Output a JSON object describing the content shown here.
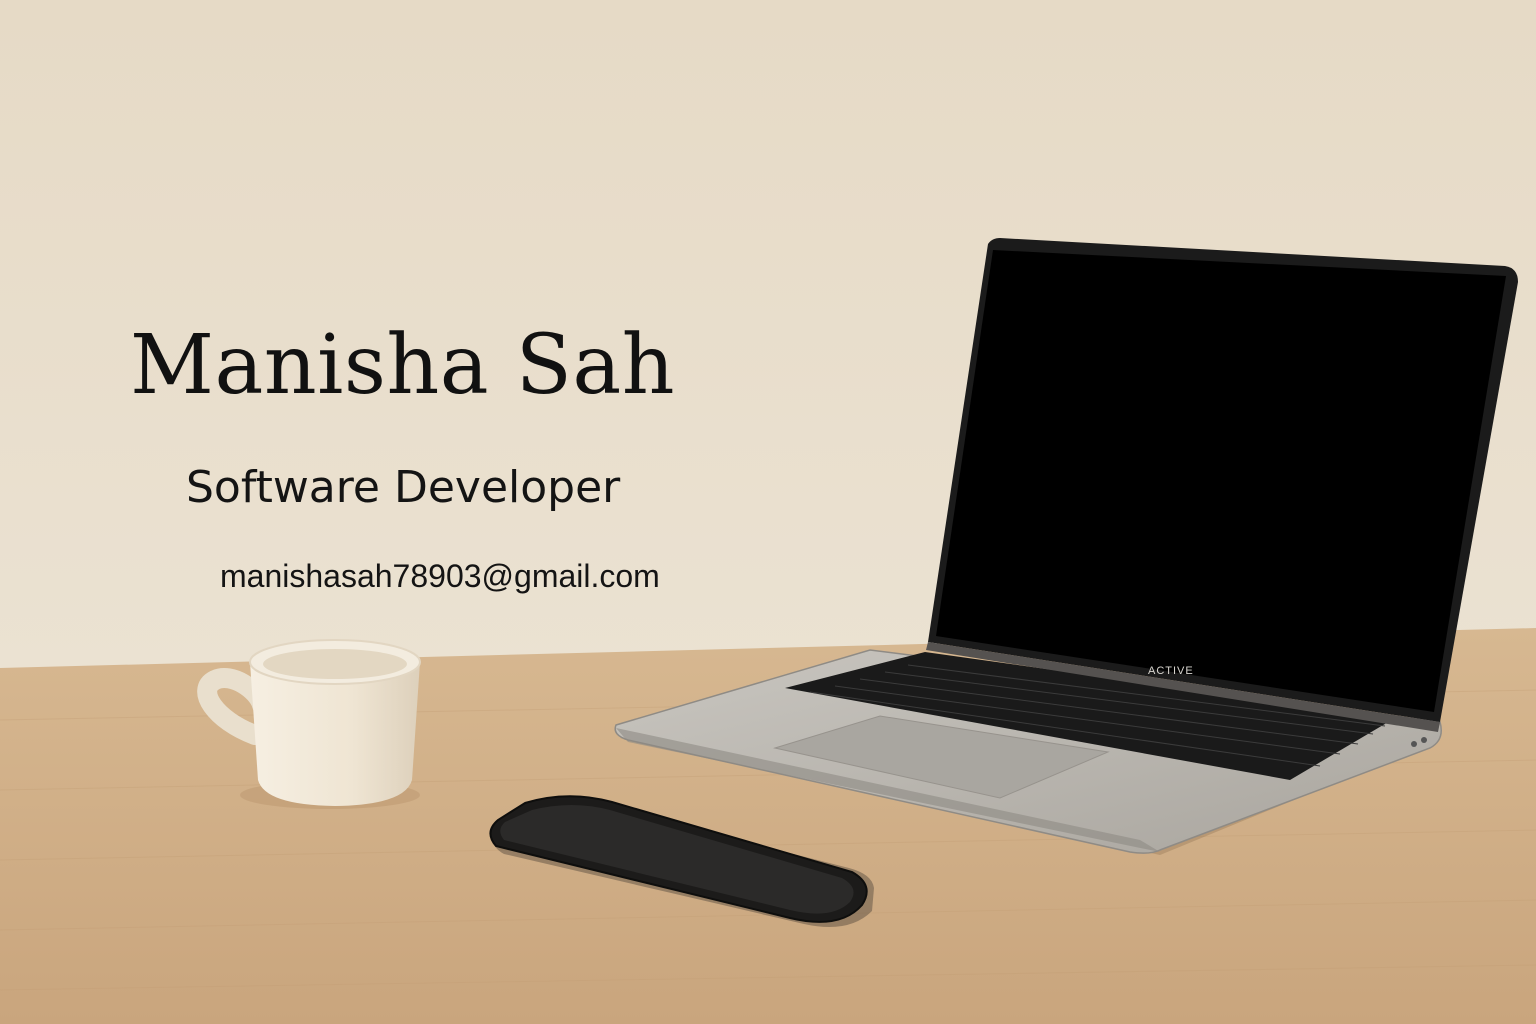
{
  "card": {
    "name": "Manisha Sah",
    "title": "Software Developer",
    "email": "manishasah78903@gmail.com"
  },
  "laptop": {
    "brand_label": "ACTIVE"
  },
  "icons": {
    "mug": "coffee-mug-icon",
    "phone": "smartphone-icon",
    "laptop": "laptop-icon"
  },
  "colors": {
    "wall": "#e7dcc9",
    "desk": "#cfae88",
    "text": "#111111",
    "screen": "#000000",
    "laptop_body": "#b9b6b0"
  }
}
